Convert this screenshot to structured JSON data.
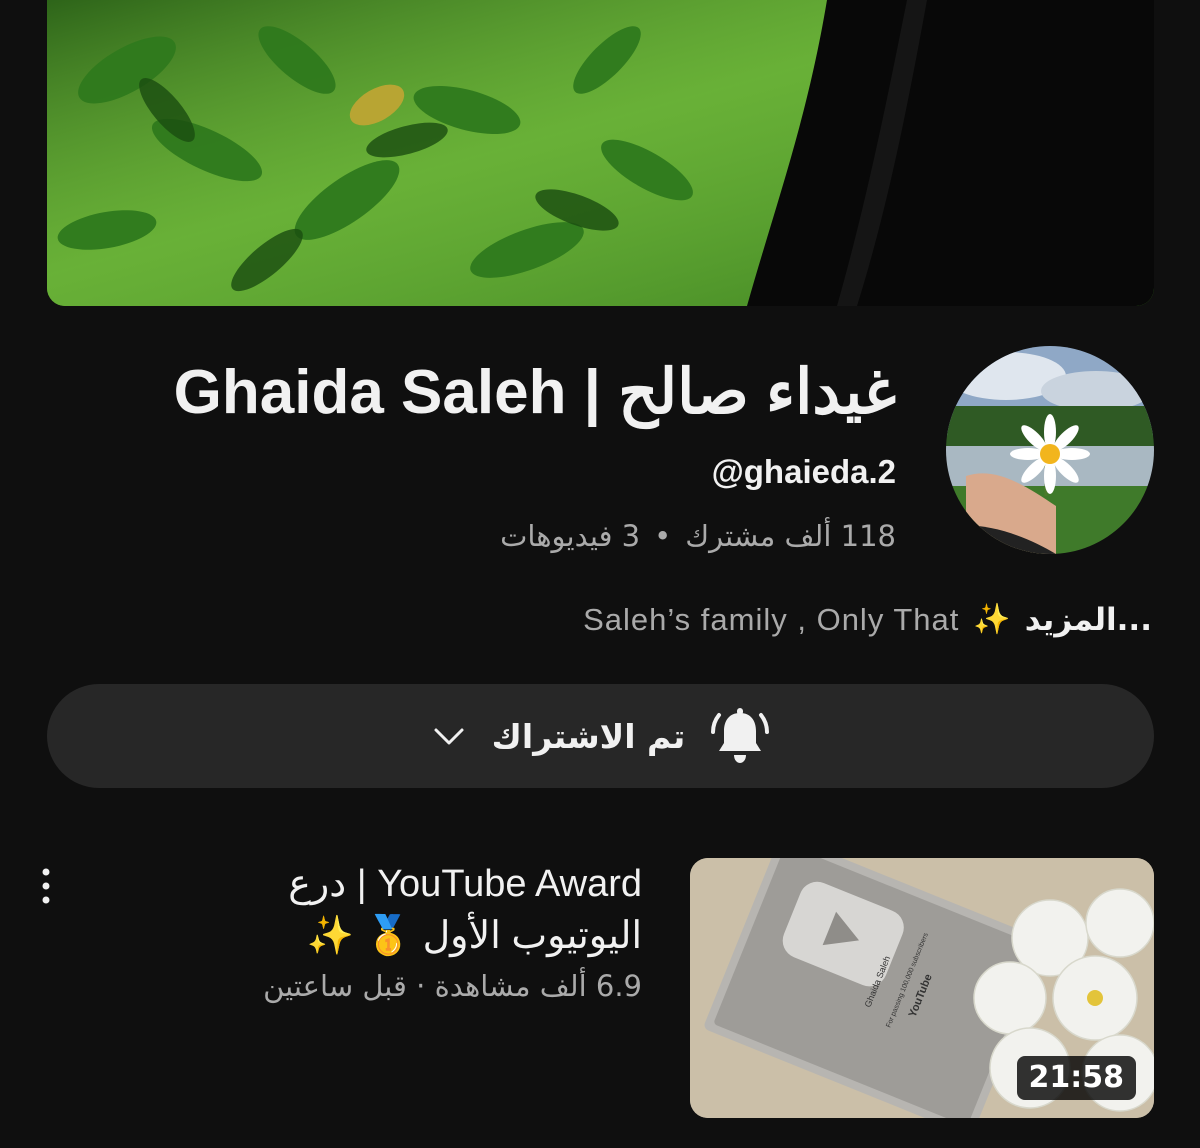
{
  "channel": {
    "title": "Ghaida Saleh | غيداء صالح",
    "handle": "@ghaieda.2",
    "subscribers": "118 ألف مشترك",
    "separator": "•",
    "videos": "3 فيديوهات",
    "description": "Saleh’s family , Only That",
    "description_emoji": "✨",
    "more_label": "المزيد..."
  },
  "subscribe": {
    "label": "تم الاشتراك"
  },
  "video": {
    "title": "YouTube Award | درع اليوتيوب الأول 🥇 ✨",
    "meta": "6.9 ألف مشاهدة · قبل ساعتين",
    "duration": "21:58",
    "plaque_name": "Ghaida Saleh",
    "plaque_text": "For passing 100,000 subscribers",
    "plaque_brand": "YouTube"
  },
  "icons": {
    "bell": "bell-ringing-icon",
    "chevron": "chevron-down-icon",
    "more": "more-vertical-icon"
  },
  "colors": {
    "background": "#0f0f0f",
    "button_bg": "#272727",
    "text_primary": "#f1f1f1",
    "text_secondary": "#aaaaaa"
  }
}
